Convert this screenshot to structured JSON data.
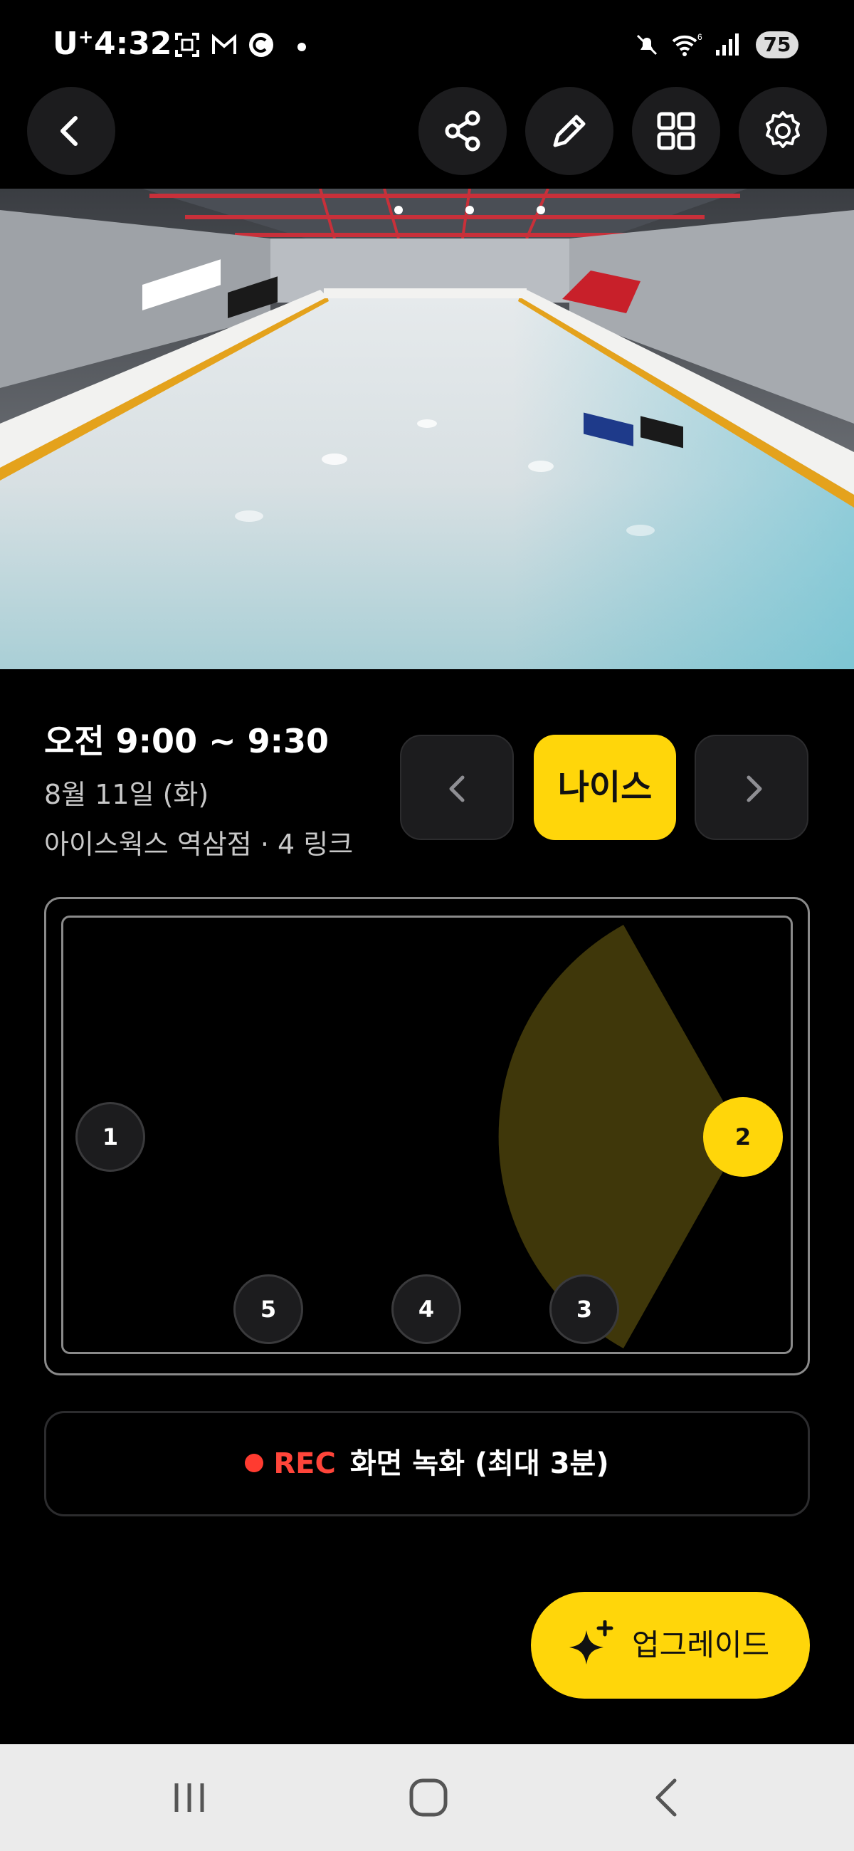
{
  "status_bar": {
    "carrier": "U",
    "carrier_sup": "+",
    "time": "4:32",
    "notification_icons": [
      "screenshot-icon",
      "gmail-icon",
      "c-app-icon"
    ],
    "system_icons": [
      "mute-icon",
      "wifi-icon",
      "signal-icon"
    ],
    "battery": "75"
  },
  "toolbar": {
    "buttons": [
      "back-icon",
      "share-icon",
      "edit-icon",
      "grid-icon",
      "settings-icon"
    ]
  },
  "session": {
    "time_range": "오전 9:00 ~ 9:30",
    "date": "8월 11일 (화)",
    "venue": "아이스웍스 역삼점 · 4 링크"
  },
  "reaction_button": "나이스",
  "map": {
    "cameras": [
      "1",
      "2",
      "3",
      "4",
      "5"
    ],
    "active_camera": "2",
    "accent": "#ffd60a",
    "fov_color": "#3f370a"
  },
  "record": {
    "label": "REC",
    "text": "화면 녹화 (최대 3분)"
  },
  "upgrade_button": "업그레이드",
  "colors": {
    "background": "#000000",
    "surface": "#1c1c1e",
    "accent": "#ffd60a",
    "rec": "#ff3b30"
  }
}
